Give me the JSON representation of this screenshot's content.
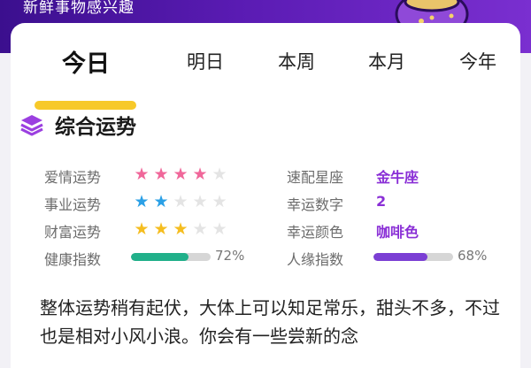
{
  "banner": {
    "text": "新鲜事物感兴趣"
  },
  "tabs": [
    {
      "label": "今日",
      "active": true
    },
    {
      "label": "明日",
      "active": false
    },
    {
      "label": "本周",
      "active": false
    },
    {
      "label": "本月",
      "active": false
    },
    {
      "label": "今年",
      "active": false
    }
  ],
  "section": {
    "title": "综合运势",
    "icon": "layers-icon"
  },
  "left_rows": [
    {
      "label": "爱情运势",
      "type": "stars",
      "rating": 4,
      "max": 5,
      "color": "#f0679a"
    },
    {
      "label": "事业运势",
      "type": "stars",
      "rating": 2,
      "max": 5,
      "color": "#2ba0e6"
    },
    {
      "label": "财富运势",
      "type": "stars",
      "rating": 3,
      "max": 5,
      "color": "#f5bd1f"
    },
    {
      "label": "健康指数",
      "type": "bar",
      "percent": 72,
      "percent_text": "72%",
      "color": "#21b08a"
    }
  ],
  "right_rows": [
    {
      "label": "速配星座",
      "value": "金牛座"
    },
    {
      "label": "幸运数字",
      "value": "2"
    },
    {
      "label": "幸运颜色",
      "value": "咖啡色"
    },
    {
      "label": "人缘指数",
      "type": "bar",
      "percent": 68,
      "percent_text": "68%",
      "color": "#7b3fd4"
    }
  ],
  "description": "整体运势稍有起伏，大体上可以知足常乐，甜头不多，不过也是相对小风小浪。你会有一些尝新的念",
  "colors": {
    "star_empty": "#e4e4e4",
    "accent": "#8a2fd6",
    "tab_underline": "#f7c92a"
  }
}
